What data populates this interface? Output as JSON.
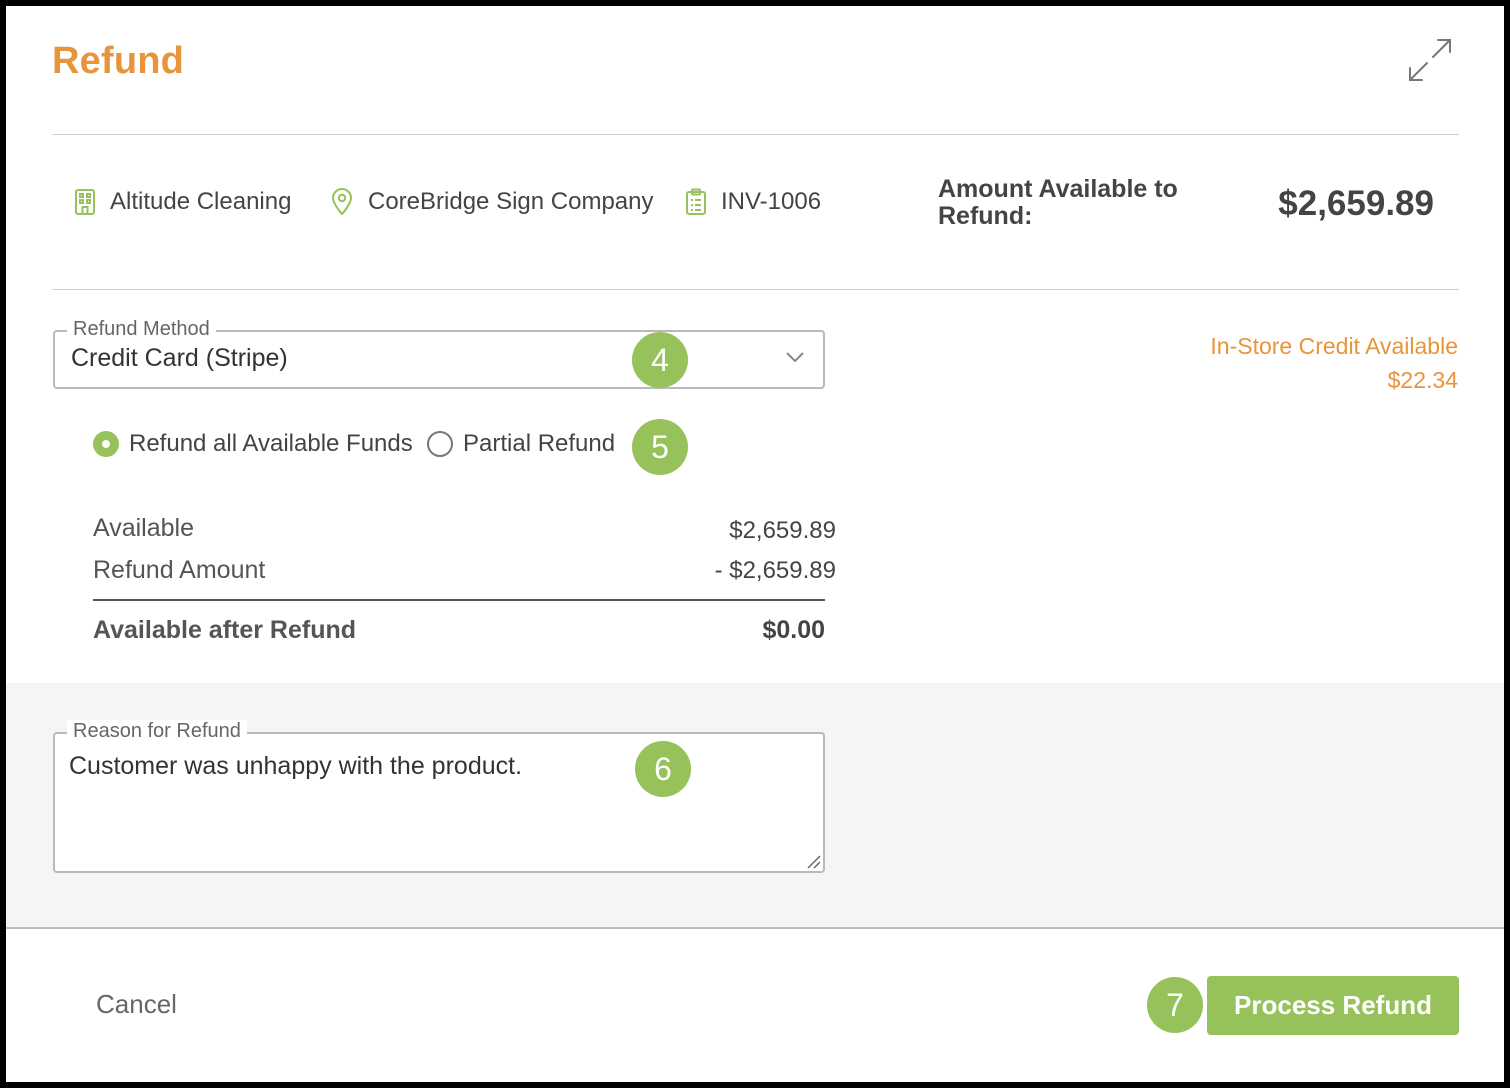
{
  "modal": {
    "title": "Refund",
    "expand_icon": "expand-arrows-icon"
  },
  "info": {
    "company": {
      "icon": "building-icon",
      "label": "Altitude Cleaning"
    },
    "location": {
      "icon": "map-pin-icon",
      "label": "CoreBridge Sign Company"
    },
    "invoice": {
      "icon": "clipboard-icon",
      "label": "INV-1006"
    },
    "amount_label": "Amount Available to Refund:",
    "amount_value": "$2,659.89"
  },
  "refund_method": {
    "legend": "Refund Method",
    "value": "Credit Card (Stripe)",
    "icon": "chevron-down-icon"
  },
  "store_credit": {
    "label": "In-Store Credit Available",
    "value": "$22.34"
  },
  "refund_type": {
    "options": [
      {
        "label": "Refund all Available Funds",
        "selected": true
      },
      {
        "label": "Partial Refund",
        "selected": false
      }
    ]
  },
  "summary": {
    "available_label": "Available",
    "available_value": "$2,659.89",
    "refund_label": "Refund Amount",
    "refund_value": "- $2,659.89",
    "after_label": "Available after Refund",
    "after_value": "$0.00"
  },
  "reason": {
    "legend": "Reason for Refund",
    "value": "Customer was unhappy with the product."
  },
  "steps": [
    "4",
    "5",
    "6",
    "7"
  ],
  "footer": {
    "cancel_label": "Cancel",
    "process_label": "Process Refund"
  },
  "colors": {
    "accent_orange": "#e8943a",
    "accent_green": "#97c15b",
    "text": "#444444"
  }
}
